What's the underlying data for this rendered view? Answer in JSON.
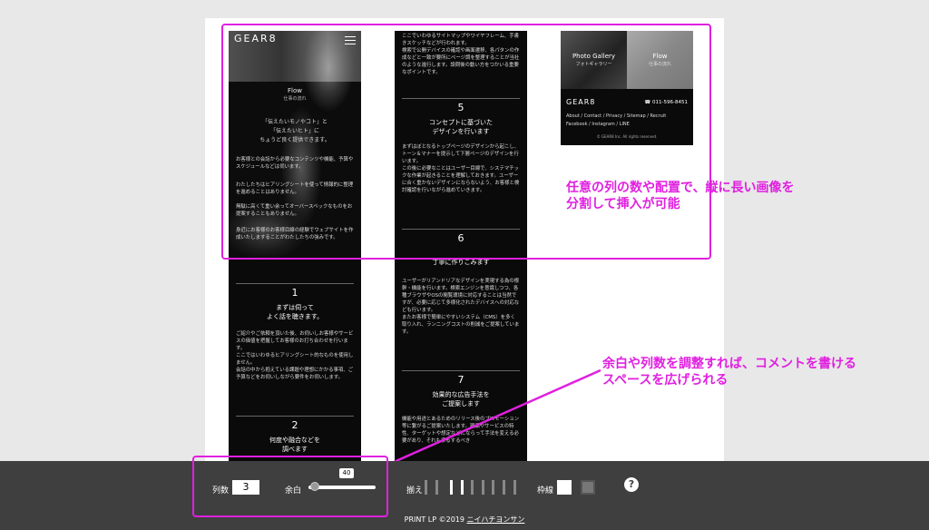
{
  "preview": {
    "col1": {
      "logo": "GEAR8",
      "flow_title": "Flow",
      "flow_sub": "仕事の流れ",
      "lead": "「伝えたいモノやコト」と\n「伝えたいヒト」に\nちょうど良く提供できます。",
      "para1": "お客様との会話から必要なコンテンツや機能、予算やスケジュールなどは伺います。",
      "para2": "わたしたちはヒアリングシートを使って情報的に整理を進めることはありません。",
      "para3": "無駄に高くて重い余ってオーバースペックなものをお提案することもありません。",
      "para4": "身近にお客様のお客様目線の経験でウェブサイトを作成いたしますることがわたしたちの強みです。",
      "sec1_num": "1",
      "sec1_title": "まずは伺って\nよく話を聴きます。",
      "sec1_body": "ご紹介やご依頼を頂いた後、お伺いしお客様やサービスの価値を把握してお客様のお打ち合わせを行います。\nここではいわゆるヒアリングシート的なものを使用しません。\n会話の中から抱えている課題や理想にかかる事項、ご予算などをお伺いしながら要件をお伺いします。",
      "sec2_num": "2",
      "sec2_title": "何度や融合などを\n調べます"
    },
    "col2": {
      "top": "ここでいわゆるサイトマップやワイヤフレーム、手書きスケッチなどが行われます。\n検索で公開デバイスの確認や画面遷移、各パタンの作成などと一致が要所にページ調を整理することが当社のような進行します。設問後の動い方をつかいる重要なポイントです。",
      "sec5_num": "5",
      "sec5_title": "コンセプトに基づいた\nデザインを行います",
      "sec5_body": "まずはぼとなるトップページのデザインから起こし、トーン＆マナーを提示して下層ページのデザインを行います。\nこの後に必要なことはユーザー目線で、システマチックな作業が起きることを理解しておきます。ユーザーに合く重かないデザインにならないよう、お客様と検討確認を行いながら進めていきます。",
      "sec6_num": "6",
      "sec6_title": "丁寧に作りこみます",
      "sec6_body": "ユーザーがリアンドリアなデザインを実現する為の根幹・機能を行います。検索エンジンを意識しつつ、各種ブラウザやOSの閲覧環境に対応することは当然ですが、必要に応じて多様化されたデバイスへの対応なども行います。\nまたお客様で簡単にやすいシステム（CMS）を多く取り入れ、ランニングコストの削減をご提案しています。",
      "sec7_num": "7",
      "sec7_title": "効果的な広告手法を\nご提案します",
      "sec7_body": "機能や用途とあるためのリリース後のプロモーション等に繋がるご提案いたします。現品やサービスの特性、ターゲットや想定などにならって手法を変える必要があり、それも承るするべき"
    },
    "col3": {
      "gallery1_title": "Photo Gallery",
      "gallery1_sub": "フォトギャラリー",
      "gallery2_title": "Flow",
      "gallery2_sub": "仕事の流れ",
      "footer_logo": "GEAR8",
      "tel": "011-596-8451",
      "links1": "About / Contact / Privacy / Sitemap / Recruit",
      "links2": "Facebook / Instagram / LINE",
      "copyright": "© GEAR8 Inc. All rights reserved."
    }
  },
  "annotations": {
    "note1": "任意の列の数や配置で、縦に長い画像を\n分割して挿入が可能",
    "note2": "余白や列数を調整すれば、コメントを書ける\nスペースを広げられる",
    "color": "#e020e0"
  },
  "toolbar": {
    "columns_label": "列数",
    "columns_value": "3",
    "margin_label": "余白",
    "margin_value": "40",
    "margin_level": 0.02,
    "align_label": "揃え",
    "border_label": "枠線",
    "help": "?"
  },
  "footer": {
    "text": "PRINT LP ©2019",
    "link": "ニイハチヨンサン"
  }
}
